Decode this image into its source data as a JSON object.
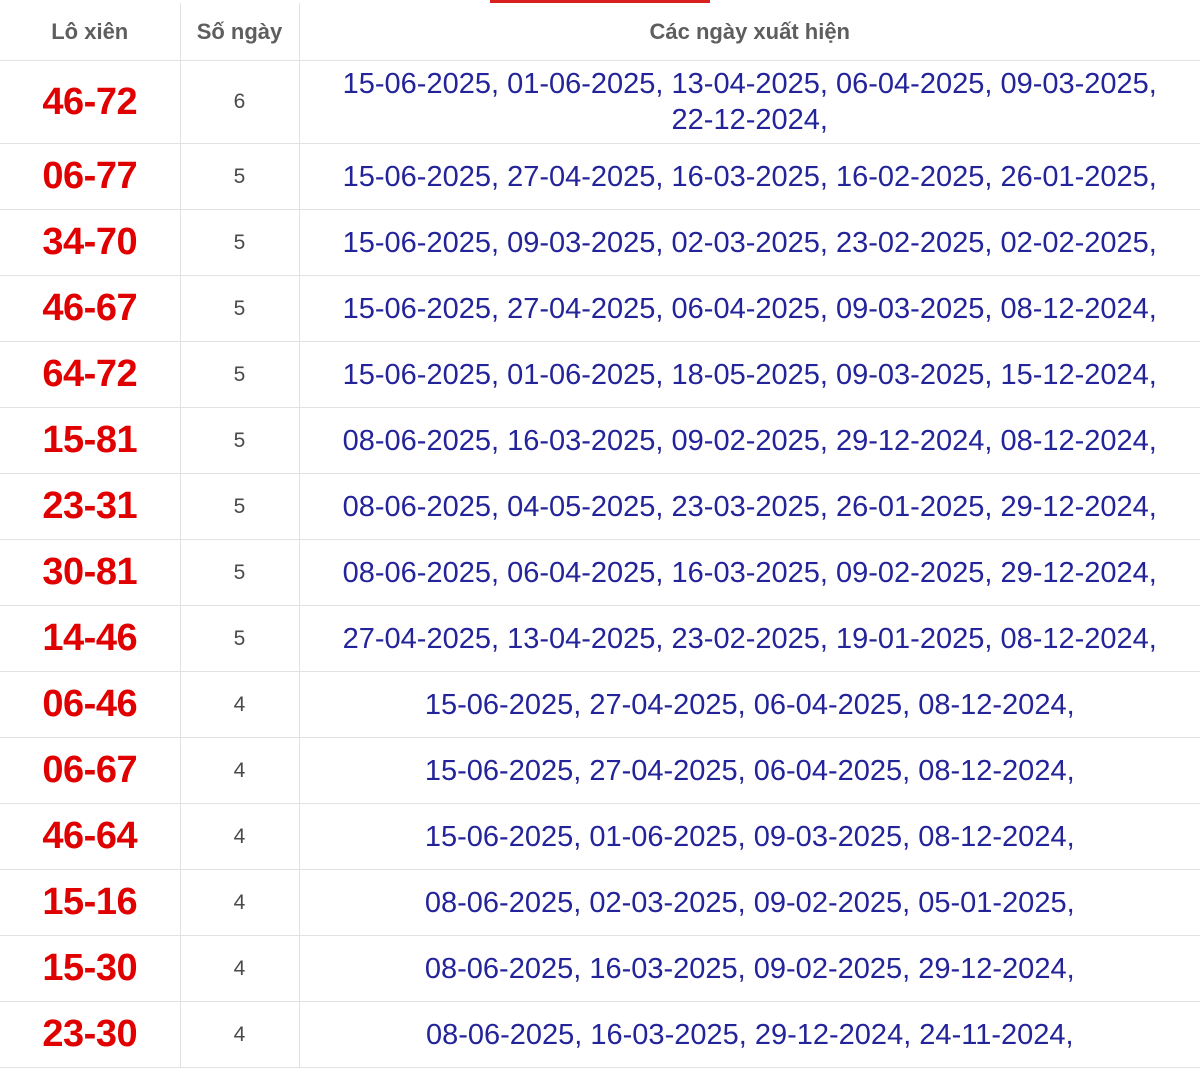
{
  "headers": {
    "pair": "Lô xiên",
    "days": "Số ngày",
    "dates": "Các ngày xuất hiện"
  },
  "colors": {
    "pair_text": "#e00000",
    "dates_text": "#23239a",
    "header_text": "#5e5e5e",
    "accent": "#d8201f"
  },
  "rows": [
    {
      "pair": "46-72",
      "days": "6",
      "dates": "15-06-2025, 01-06-2025, 13-04-2025, 06-04-2025, 09-03-2025, 22-12-2024,"
    },
    {
      "pair": "06-77",
      "days": "5",
      "dates": "15-06-2025, 27-04-2025, 16-03-2025, 16-02-2025, 26-01-2025,"
    },
    {
      "pair": "34-70",
      "days": "5",
      "dates": "15-06-2025, 09-03-2025, 02-03-2025, 23-02-2025, 02-02-2025,"
    },
    {
      "pair": "46-67",
      "days": "5",
      "dates": "15-06-2025, 27-04-2025, 06-04-2025, 09-03-2025, 08-12-2024,"
    },
    {
      "pair": "64-72",
      "days": "5",
      "dates": "15-06-2025, 01-06-2025, 18-05-2025, 09-03-2025, 15-12-2024,"
    },
    {
      "pair": "15-81",
      "days": "5",
      "dates": "08-06-2025, 16-03-2025, 09-02-2025, 29-12-2024, 08-12-2024,"
    },
    {
      "pair": "23-31",
      "days": "5",
      "dates": "08-06-2025, 04-05-2025, 23-03-2025, 26-01-2025, 29-12-2024,"
    },
    {
      "pair": "30-81",
      "days": "5",
      "dates": "08-06-2025, 06-04-2025, 16-03-2025, 09-02-2025, 29-12-2024,"
    },
    {
      "pair": "14-46",
      "days": "5",
      "dates": "27-04-2025, 13-04-2025, 23-02-2025, 19-01-2025, 08-12-2024,"
    },
    {
      "pair": "06-46",
      "days": "4",
      "dates": "15-06-2025, 27-04-2025, 06-04-2025, 08-12-2024,"
    },
    {
      "pair": "06-67",
      "days": "4",
      "dates": "15-06-2025, 27-04-2025, 06-04-2025, 08-12-2024,"
    },
    {
      "pair": "46-64",
      "days": "4",
      "dates": "15-06-2025, 01-06-2025, 09-03-2025, 08-12-2024,"
    },
    {
      "pair": "15-16",
      "days": "4",
      "dates": "08-06-2025, 02-03-2025, 09-02-2025, 05-01-2025,"
    },
    {
      "pair": "15-30",
      "days": "4",
      "dates": "08-06-2025, 16-03-2025, 09-02-2025, 29-12-2024,"
    },
    {
      "pair": "23-30",
      "days": "4",
      "dates": "08-06-2025, 16-03-2025, 29-12-2024, 24-11-2024,"
    }
  ]
}
